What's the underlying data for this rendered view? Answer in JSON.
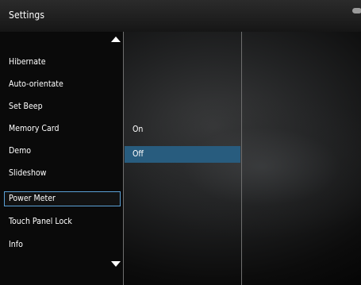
{
  "header": {
    "title": "Settings"
  },
  "menu": {
    "items": [
      {
        "label": "Hibernate"
      },
      {
        "label": "Auto-orientate"
      },
      {
        "label": "Set Beep"
      },
      {
        "label": "Memory Card"
      },
      {
        "label": "Demo"
      },
      {
        "label": "Slideshow"
      },
      {
        "label": "Power Meter"
      },
      {
        "label": "Touch Panel Lock"
      },
      {
        "label": "Info"
      }
    ],
    "selected": "Power Meter"
  },
  "options": {
    "items": [
      {
        "label": "On"
      },
      {
        "label": "Off"
      }
    ],
    "highlighted": "Off"
  },
  "icons": {
    "scroll_up": "triangle-up-icon",
    "scroll_down": "triangle-down-icon",
    "corner": "power-status-icon"
  },
  "colors": {
    "selection_border": "#5aa0d5",
    "highlight_bg": "#285c7e"
  }
}
